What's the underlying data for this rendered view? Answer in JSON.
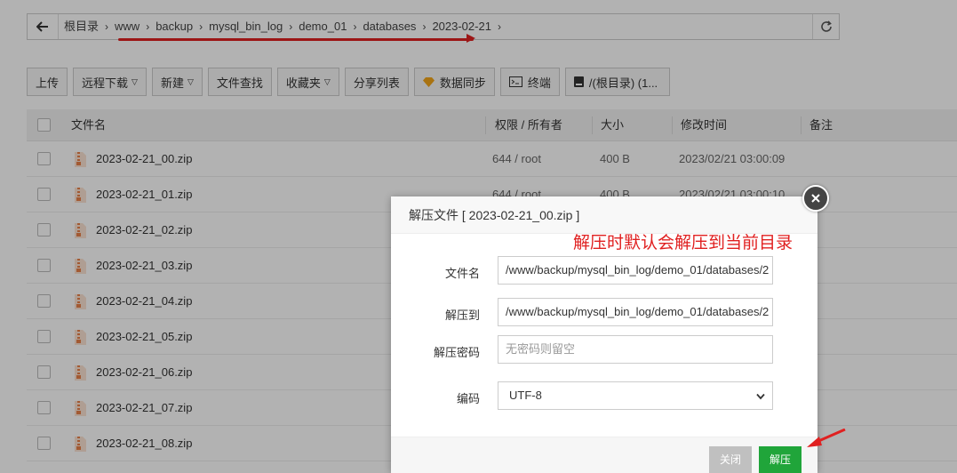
{
  "breadcrumb": {
    "items": [
      "根目录",
      "www",
      "backup",
      "mysql_bin_log",
      "demo_01",
      "databases",
      "2023-02-21"
    ]
  },
  "toolbar": {
    "upload": "上传",
    "remote_download": "远程下载",
    "new": "新建",
    "file_search": "文件查找",
    "favorites": "收藏夹",
    "share_list": "分享列表",
    "data_sync": "数据同步",
    "terminal": "终端",
    "disk": "/(根目录) (1..."
  },
  "table": {
    "headers": {
      "name": "文件名",
      "perm": "权限 / 所有者",
      "size": "大小",
      "mtime": "修改时间",
      "note": "备注"
    },
    "rows": [
      {
        "name": "2023-02-21_00.zip",
        "perm": "644 / root",
        "size": "400 B",
        "mtime": "2023/02/21 03:00:09"
      },
      {
        "name": "2023-02-21_01.zip",
        "perm": "644 / root",
        "size": "400 B",
        "mtime": "2023/02/21 03:00:10"
      },
      {
        "name": "2023-02-21_02.zip",
        "perm": "",
        "size": "",
        "mtime": ""
      },
      {
        "name": "2023-02-21_03.zip",
        "perm": "",
        "size": "",
        "mtime": ""
      },
      {
        "name": "2023-02-21_04.zip",
        "perm": "",
        "size": "",
        "mtime": ""
      },
      {
        "name": "2023-02-21_05.zip",
        "perm": "",
        "size": "",
        "mtime": ""
      },
      {
        "name": "2023-02-21_06.zip",
        "perm": "",
        "size": "",
        "mtime": ""
      },
      {
        "name": "2023-02-21_07.zip",
        "perm": "",
        "size": "",
        "mtime": ""
      },
      {
        "name": "2023-02-21_08.zip",
        "perm": "",
        "size": "",
        "mtime": ""
      }
    ]
  },
  "dialog": {
    "title": "解压文件 [ 2023-02-21_00.zip ]",
    "annotation": "解压时默认会解压到当前目录",
    "fields": {
      "filename_label": "文件名",
      "filename_value": "/www/backup/mysql_bin_log/demo_01/databases/2",
      "extract_to_label": "解压到",
      "extract_to_value": "/www/backup/mysql_bin_log/demo_01/databases/2",
      "password_label": "解压密码",
      "password_placeholder": "无密码则留空",
      "encoding_label": "编码",
      "encoding_value": "UTF-8"
    },
    "buttons": {
      "close": "关闭",
      "extract": "解压"
    }
  },
  "colors": {
    "annotation_red": "#e02020",
    "primary_green": "#20a53a",
    "button_gray": "#c0c0c0",
    "zip_icon_orange": "#e8824a"
  },
  "icons": {
    "back": "arrow-left-icon",
    "refresh": "refresh-icon",
    "sync": "diamond-icon",
    "terminal": "terminal-icon",
    "disk": "disk-icon",
    "file": "zip-file-icon",
    "close": "close-icon"
  }
}
